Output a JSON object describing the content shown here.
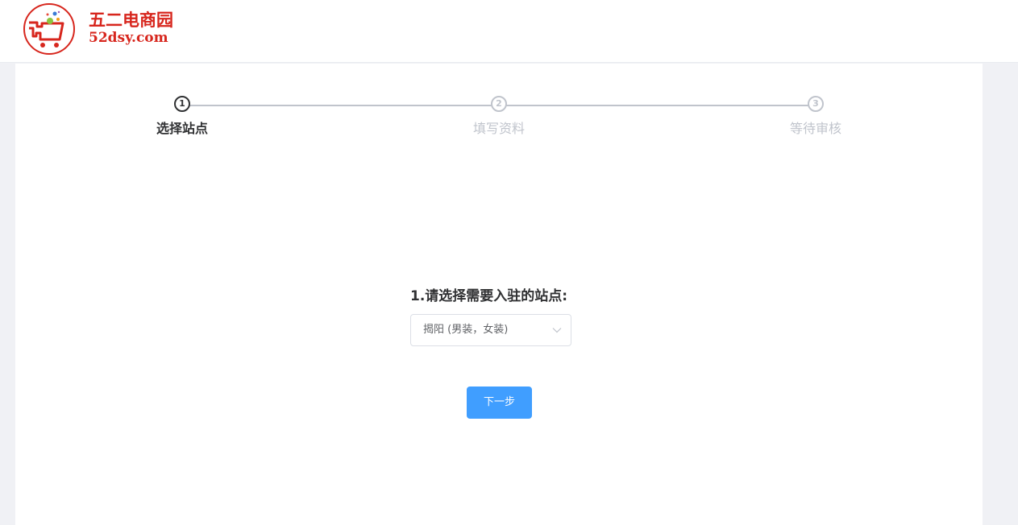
{
  "header": {
    "logo_cn": "五二电商园",
    "logo_en": "52dsy.com"
  },
  "steps": [
    {
      "number": "1",
      "title": "选择站点",
      "state": "active"
    },
    {
      "number": "2",
      "title": "填写资料",
      "state": "pending"
    },
    {
      "number": "3",
      "title": "等待审核",
      "state": "pending"
    }
  ],
  "form": {
    "label": "1.请选择需要入驻的站点:",
    "selected_site": "揭阳 (男装，女装)"
  },
  "actions": {
    "next_label": "下一步"
  },
  "colors": {
    "brand_red": "#d7261d",
    "primary_blue": "#409eff",
    "active_step": "#303133",
    "inactive_step": "#c0c4cc"
  }
}
